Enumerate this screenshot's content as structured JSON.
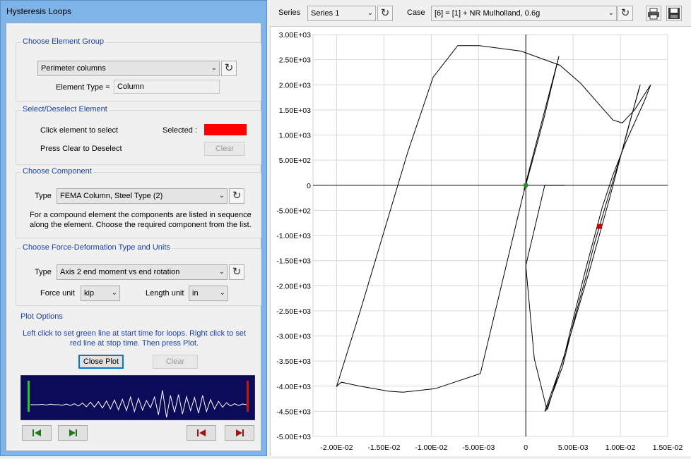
{
  "dialog": {
    "title": "Hysteresis Loops",
    "element_group": {
      "legend": "Choose Element Group",
      "group_value": "Perimeter columns",
      "element_type_label": "Element Type =",
      "element_type_value": "Column"
    },
    "select_element": {
      "legend": "Select/Deselect Element",
      "click_text": "Click element to select",
      "selected_label": "Selected :",
      "selected_color": "#ff0000",
      "clear_text": "Press Clear to Deselect",
      "clear_label": "Clear"
    },
    "component": {
      "legend": "Choose Component",
      "type_label": "Type",
      "type_value": "FEMA Column, Steel Type (2)",
      "help_line1": "For a compound element the components are listed in sequence",
      "help_line2": "along the element. Choose the required component from the list."
    },
    "force_deformation": {
      "legend": "Choose Force-Deformation Type and Units",
      "type_label": "Type",
      "type_value": "Axis 2 end moment vs end rotation",
      "force_unit_label": "Force unit",
      "force_unit_value": "kip",
      "length_unit_label": "Length unit",
      "length_unit_value": "in"
    },
    "plot_options": {
      "legend": "Plot Options",
      "help_line1": "Left click to set green line at start time for loops. Right click to set",
      "help_line2": "red line at stop time. Then press Plot.",
      "close_plot_label": "Close Plot",
      "clear_label": "Clear"
    }
  },
  "toolbar": {
    "series_label": "Series",
    "series_value": "Series 1",
    "case_label": "Case",
    "case_value": "[6] = [1] + NR Mulholland, 0.6g"
  },
  "chart_data": {
    "type": "line",
    "xlim": [
      -0.0225,
      0.015
    ],
    "ylim": [
      -5000,
      3000
    ],
    "grid": true,
    "x_ticks": [
      {
        "v": -0.02,
        "label": "-2.00E-02"
      },
      {
        "v": -0.015,
        "label": "-1.50E-02"
      },
      {
        "v": -0.01,
        "label": "-1.00E-02"
      },
      {
        "v": -0.005,
        "label": "-5.00E-03"
      },
      {
        "v": 0,
        "label": "0"
      },
      {
        "v": 0.005,
        "label": "5.00E-03"
      },
      {
        "v": 0.01,
        "label": "1.00E-02"
      },
      {
        "v": 0.015,
        "label": "1.50E-02"
      }
    ],
    "y_ticks": [
      {
        "v": 3000,
        "label": "3.00E+03"
      },
      {
        "v": 2500,
        "label": "2.50E+03"
      },
      {
        "v": 2000,
        "label": "2.00E+03"
      },
      {
        "v": 1500,
        "label": "1.50E+03"
      },
      {
        "v": 1000,
        "label": "1.00E+03"
      },
      {
        "v": 500,
        "label": "5.00E+02"
      },
      {
        "v": 0,
        "label": "0"
      },
      {
        "v": -500,
        "label": "-5.00E+02"
      },
      {
        "v": -1000,
        "label": "-1.00E+03"
      },
      {
        "v": -1500,
        "label": "-1.50E+03"
      },
      {
        "v": -2000,
        "label": "-2.00E+03"
      },
      {
        "v": -2500,
        "label": "-2.50E+03"
      },
      {
        "v": -3000,
        "label": "-3.00E+03"
      },
      {
        "v": -3500,
        "label": "-3.50E+03"
      },
      {
        "v": -4000,
        "label": "-4.00E+03"
      },
      {
        "v": -4500,
        "label": "-4.50E+03"
      },
      {
        "v": -5000,
        "label": "-5.00E+03"
      }
    ],
    "series": [
      {
        "x": [
          0,
          -0.0002,
          0.0035,
          0.0019,
          0.0013,
          0.0009,
          -0.0003,
          -0.0048,
          -0.0096,
          -0.013,
          -0.0145,
          -0.0175,
          -0.0195,
          -0.02,
          -0.0175,
          -0.0125,
          -0.0098,
          -0.0072,
          -0.0049,
          -0.0005,
          0.0036,
          0.0058,
          0.0078,
          0.0092,
          0.0102,
          0.0106,
          0.0115,
          0.0132,
          0.0125,
          0.0106,
          0.0092,
          0.0081,
          0.0064,
          0.0052,
          0.004,
          0.002,
          0.0023,
          0.0045,
          0.0067,
          0.0088,
          0.0108,
          0.0121,
          0.0119,
          0.0102,
          0.0088,
          0.0073,
          0.0062,
          0.0053,
          0.0039,
          0.0022,
          0.0009,
          0,
          0.002,
          0.0041
        ],
        "y": [
          0,
          -100,
          2570,
          1320,
          900,
          620,
          -200,
          -3750,
          -4050,
          -4120,
          -4100,
          -4000,
          -3920,
          -4000,
          -2500,
          650,
          2150,
          2780,
          2780,
          2670,
          2390,
          2030,
          1600,
          1300,
          1240,
          1320,
          1500,
          2000,
          1660,
          870,
          200,
          -430,
          -1620,
          -2520,
          -3450,
          -4500,
          -4450,
          -3120,
          -1720,
          -300,
          1130,
          2000,
          1880,
          690,
          -170,
          -1130,
          -1930,
          -2550,
          -3600,
          -4450,
          -3450,
          -1600,
          0,
          0
        ]
      }
    ],
    "start_marker": {
      "x": 0,
      "y": 0,
      "color": "#2e8b2e"
    },
    "stop_marker": {
      "x": 0.0078,
      "y": -820,
      "color": "#cc0000"
    },
    "timeline": {
      "samples": [
        0,
        0,
        0,
        0.02,
        -0.02,
        0.03,
        0,
        0,
        -0.03,
        0.04,
        -0.05,
        0.06,
        -0.08,
        0.1,
        -0.12,
        0.15,
        -0.14,
        0.18,
        -0.2,
        0.22,
        -0.25,
        0.28,
        -0.3,
        0.32,
        -0.35,
        0.45,
        -0.4,
        0.38,
        -0.32,
        0.25,
        -0.18,
        0.45,
        -0.6,
        0.85,
        -0.75,
        0.55,
        -0.45,
        0.6,
        -0.55,
        0.48,
        -0.35,
        0.42,
        -0.5,
        0.55,
        -0.4,
        0.3,
        -0.25,
        0.2,
        -0.15,
        0.12,
        -0.08,
        0.06,
        -0.05,
        0.04,
        0
      ],
      "start_color": "#22cc22",
      "stop_color": "#cc1111",
      "background": "#0b0b5a"
    }
  }
}
